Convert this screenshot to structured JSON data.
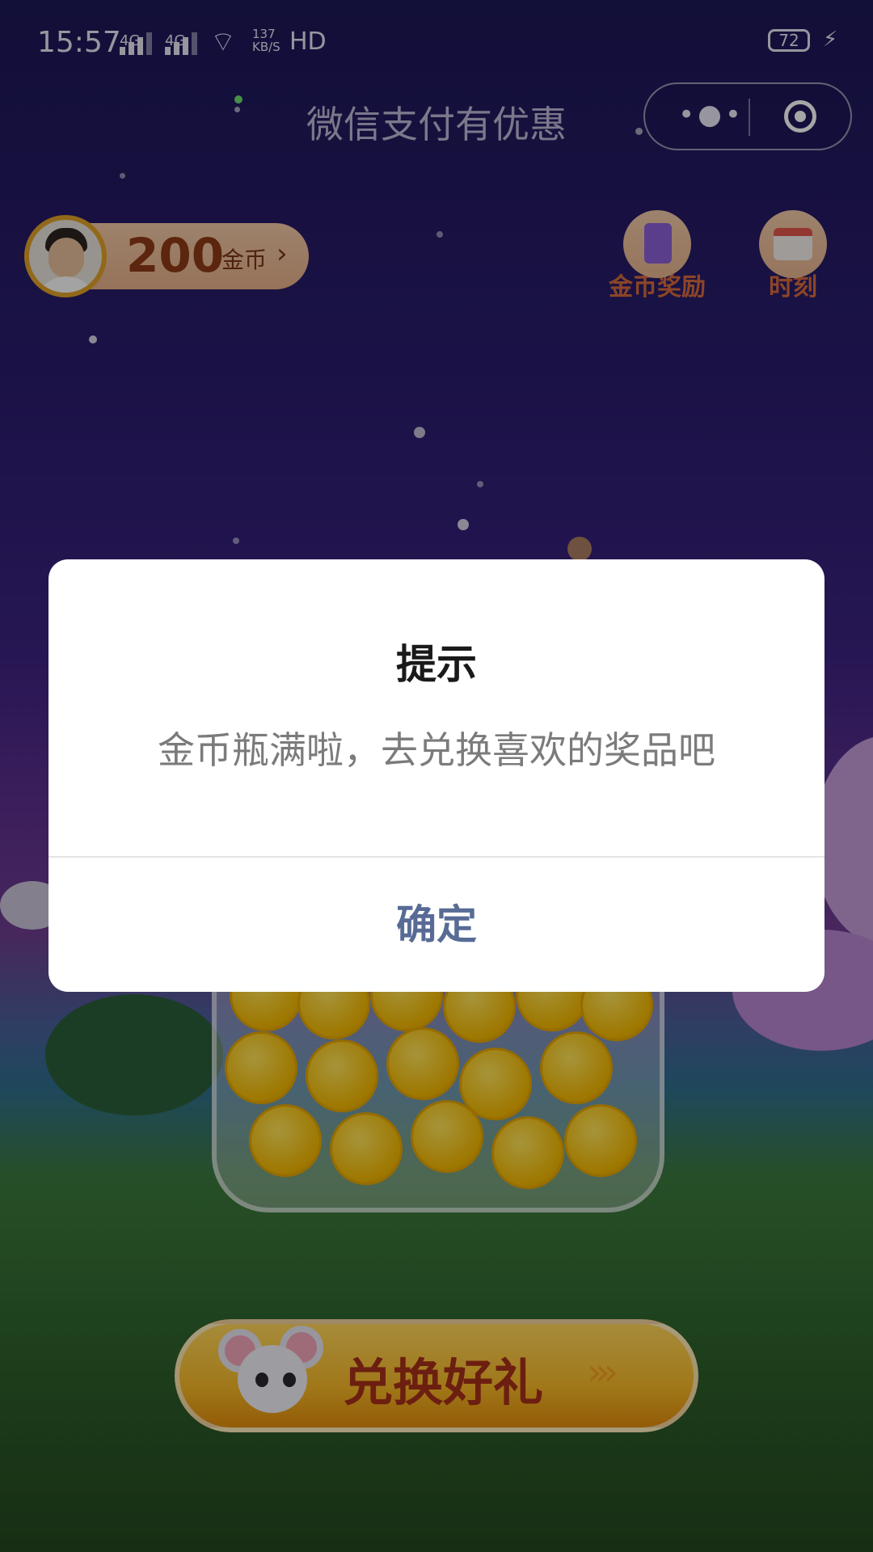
{
  "status_bar": {
    "time": "15:57",
    "signal_1": "4G",
    "signal_2": "4G",
    "net_speed": "137",
    "net_speed_unit": "KB/S",
    "hd_label": "HD",
    "battery": "72"
  },
  "nav": {
    "title": "微信支付有优惠",
    "more_icon": "more-icon",
    "close_icon": "target-icon"
  },
  "coins": {
    "amount": "200",
    "unit": "金币",
    "chevron": "›"
  },
  "side_buttons": [
    {
      "label": "金币奖励",
      "icon": "list-icon"
    },
    {
      "label": "时刻",
      "icon": "calendar-icon"
    }
  ],
  "redeem_button": {
    "label": "兑换好礼",
    "arrows": "›››"
  },
  "dialog": {
    "title": "提示",
    "message": "金币瓶满啦，去兑换喜欢的奖品吧",
    "confirm": "确定"
  },
  "colors": {
    "confirm_text": "#576b95",
    "coin_text": "#8e3a14",
    "side_label": "#d76b3c",
    "redeem_text": "#a6311a"
  }
}
